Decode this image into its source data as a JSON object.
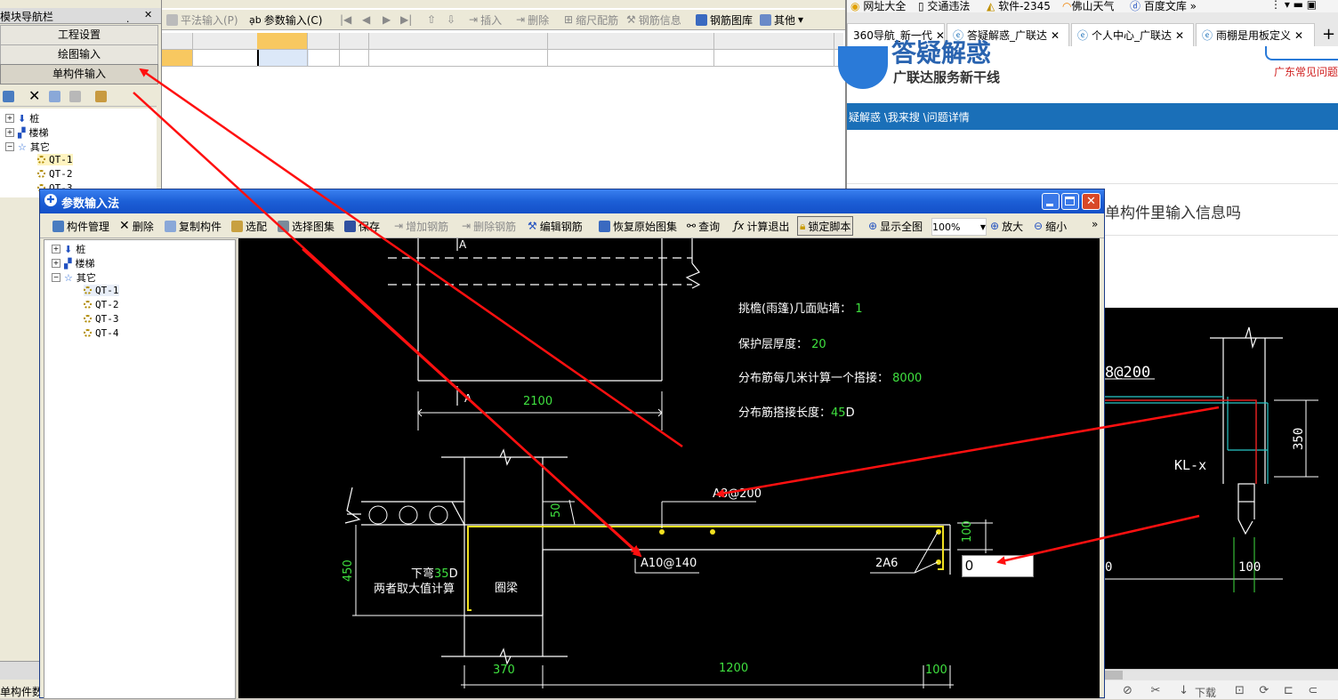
{
  "nav_panel": {
    "title": "模块导航栏",
    "pin": "ฺ",
    "close": "✕",
    "buttons": [
      "工程设置",
      "绘图输入",
      "单构件输入"
    ],
    "tree": [
      "桩",
      "楼梯",
      "其它",
      "QT-1",
      "QT-2",
      "QT-3"
    ],
    "bottom_label": "单构件数"
  },
  "main_toolbar": {
    "items": [
      "平法输入(P)",
      "参数输入(C)",
      "插入",
      "删除",
      "缩尺配筋",
      "钢筋信息",
      "钢筋图库",
      "其他"
    ]
  },
  "browser": {
    "bookmarks": [
      "网址大全",
      "交通违法",
      "软件-2345",
      "佛山天气",
      "百度文库"
    ],
    "tabs": [
      "360导航_新一代",
      "答疑解惑_广联达",
      "个人中心_广联达",
      "雨棚是用板定义"
    ],
    "new_tab": "+",
    "logo_title": "答疑解惑",
    "logo_subtitle": "广联达服务新干线",
    "side_link": "广东常见问题",
    "breadcrumb": "疑解惑 \\我来搜 \\问题详情",
    "question": "单构件里输入信息吗",
    "bottom_tools": [
      "下载"
    ]
  },
  "dialog": {
    "title": "参数输入法",
    "toolbar": [
      "构件管理",
      "删除",
      "复制构件",
      "选配",
      "选择图集",
      "保存",
      "增加钢筋",
      "删除钢筋",
      "编辑钢筋",
      "恢复原始图集",
      "查询",
      "计算退出",
      "锁定脚本",
      "显示全图",
      "100%",
      "放大",
      "缩小"
    ],
    "more": "»",
    "tree": [
      "桩",
      "楼梯",
      "其它",
      "QT-1",
      "QT-2",
      "QT-3",
      "QT-4"
    ]
  },
  "drawing": {
    "params": [
      {
        "label": "挑檐(雨篷)几面贴墙：",
        "value": "1"
      },
      {
        "label": "保护层厚度：",
        "value": "20"
      },
      {
        "label": "分布筋每几米计算一个搭接：",
        "value": "8000"
      },
      {
        "label": "分布筋搭接长度：",
        "value": "45",
        "suffix": "D"
      }
    ],
    "dim_2100": "2100",
    "label_A_top": "A",
    "label_A_mid": "A",
    "rebar_top": "A8@200",
    "rebar_bottom": "A10@140",
    "rebar_side": "2A6",
    "dim_50": "50",
    "dim_100_right": "100",
    "dim_450": "450",
    "bend_label": "下弯",
    "bend_value": "35",
    "bend_suffix": "D",
    "bend_note": "两者取大值计算",
    "beam_label": "圈梁",
    "dim_370": "370",
    "dim_1200": "1200",
    "dim_100_bottom": "100",
    "input_value": "0"
  },
  "ref_drawing": {
    "rebar": "8@200",
    "beam": "KL-x",
    "dim_350": "350",
    "dim_100": "100",
    "dim_0": "0"
  },
  "colors": {
    "cad_bg": "#000000",
    "cad_green": "#3fe03f",
    "cad_yellow": "#f0e020",
    "arrow_red": "#ff1010",
    "dialog_title": "#1c5fd6",
    "browser_blue": "#1a6fb8"
  }
}
